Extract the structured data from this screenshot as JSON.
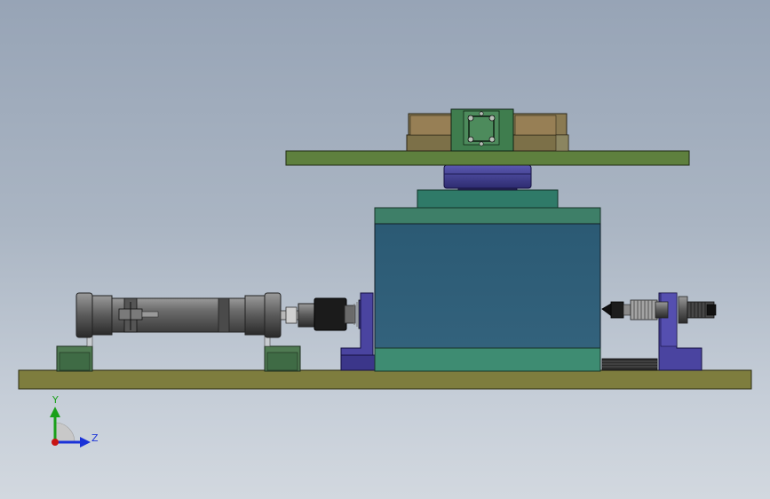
{
  "view": {
    "background_top": "#97a4b6",
    "background_bottom": "#d2d8df"
  },
  "colors": {
    "base_plate": "#7e7d3e",
    "main_block": "#2f5d78",
    "block_green": "#3e7f68",
    "top_plate": "#5e803e",
    "bracket_purple": "#4a44a0",
    "cylinder_gray": "#6a6a6a",
    "clamp_tan": "#8a7a52",
    "support_green": "#4f7a52"
  },
  "triad": {
    "y_label": "Y",
    "z_label": "Z",
    "y_color": "#1aa01a",
    "z_color": "#1a32d8",
    "x_color": "#c81414"
  }
}
